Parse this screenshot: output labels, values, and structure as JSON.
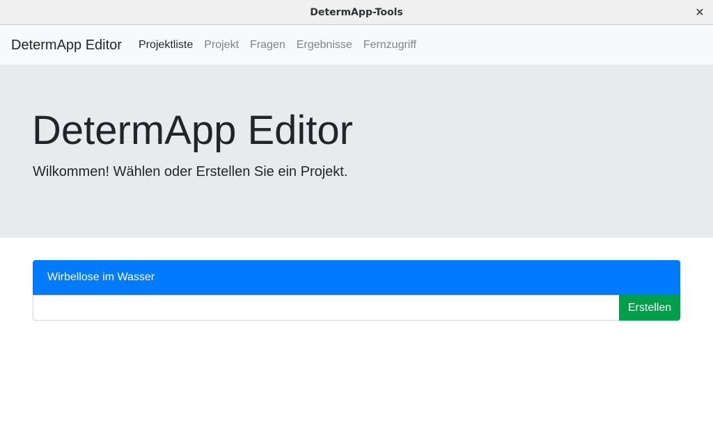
{
  "window": {
    "title": "DetermApp-Tools",
    "close_symbol": "✕"
  },
  "navbar": {
    "brand": "DetermApp Editor",
    "links": [
      {
        "label": "Projektliste",
        "active": true
      },
      {
        "label": "Projekt",
        "active": false
      },
      {
        "label": "Fragen",
        "active": false
      },
      {
        "label": "Ergebnisse",
        "active": false
      },
      {
        "label": "Fernzugriff",
        "active": false
      }
    ]
  },
  "jumbotron": {
    "headline": "DetermApp Editor",
    "lead": "Wilkommen! Wählen oder Erstellen Sie ein Projekt."
  },
  "projects": {
    "items": [
      {
        "name": "Wirbellose im Wasser"
      }
    ],
    "new_project": {
      "value": "",
      "placeholder": "",
      "button_label": "Erstellen"
    }
  },
  "colors": {
    "primary": "#007bff",
    "success": "#00a04a",
    "jumbotron_bg": "#e8ebee",
    "navbar_bg": "#f8f9fa"
  }
}
